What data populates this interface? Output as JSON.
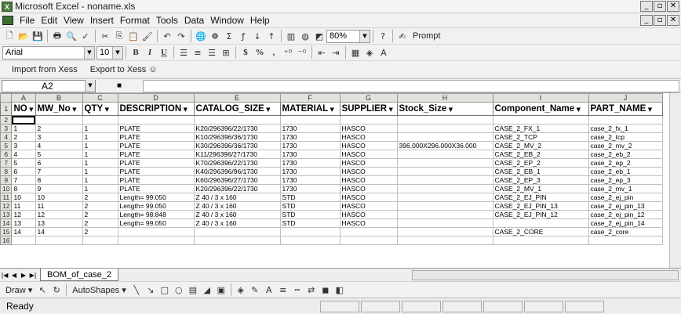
{
  "window": {
    "app_icon_text": "X",
    "title": "Microsoft Excel - noname.xls",
    "btn_min": "_",
    "btn_max": "▫",
    "btn_close": "✕"
  },
  "menu": [
    "File",
    "Edit",
    "View",
    "Insert",
    "Format",
    "Tools",
    "Data",
    "Window",
    "Help"
  ],
  "toolbar": {
    "zoom": "80%",
    "help": "?",
    "prompt": "Prompt",
    "font": "Arial",
    "font_size": "10",
    "bold": "B",
    "italic": "I",
    "underline": "U",
    "currency": "$",
    "percent": "%",
    "comma": ",",
    "import_xess": "Import from Xess",
    "export_xess": "Export to Xess ☺"
  },
  "formula_bar": {
    "name_box": "A2",
    "fx": "■",
    "value": ""
  },
  "grid": {
    "columns": [
      "A",
      "B",
      "C",
      "D",
      "E",
      "F",
      "G",
      "H",
      "I",
      "J"
    ],
    "headers": [
      "NO",
      "MW_No",
      "QTY",
      "DESCRIPTION",
      "CATALOG_SIZE",
      "MATERIAL",
      "SUPPLIER",
      "Stock_Size",
      "Component_Name",
      "PART_NAME"
    ],
    "row_numbers": [
      "1",
      "2",
      "3",
      "4",
      "5",
      "6",
      "7",
      "8",
      "9",
      "10",
      "11",
      "12",
      "13",
      "14",
      "15",
      "16"
    ],
    "rows": [
      [
        "",
        "",
        "",
        "",
        "",
        "",
        "",
        "",
        "",
        ""
      ],
      [
        "1",
        "2",
        "1",
        "PLATE",
        "K20/296396/22/1730",
        "1730",
        "HASCO",
        "",
        "CASE_2_FX_1",
        "case_2_fx_1"
      ],
      [
        "2",
        "3",
        "1",
        "PLATE",
        "K10/296396/36/1730",
        "1730",
        "HASCO",
        "",
        "CASE_2_TCP",
        "case_2_tcp"
      ],
      [
        "3",
        "4",
        "1",
        "PLATE",
        "K30/296396/36/1730",
        "1730",
        "HASCO",
        "396.000X296.000X36.000",
        "CASE_2_MV_2",
        "case_2_mv_2"
      ],
      [
        "4",
        "5",
        "1",
        "PLATE",
        "K11/296396/27/1730",
        "1730",
        "HASCO",
        "",
        "CASE_2_EB_2",
        "case_2_eb_2"
      ],
      [
        "5",
        "6",
        "1",
        "PLATE",
        "K70/296396/22/1730",
        "1730",
        "HASCO",
        "",
        "CASE_2_EP_2",
        "case_2_ep_2"
      ],
      [
        "6",
        "7",
        "1",
        "PLATE",
        "K40/296396/96/1730",
        "1730",
        "HASCO",
        "",
        "CASE_2_EB_1",
        "case_2_eb_1"
      ],
      [
        "7",
        "8",
        "1",
        "PLATE",
        "K60/296396/27/1730",
        "1730",
        "HASCO",
        "",
        "CASE_2_EP_3",
        "case_2_ep_3"
      ],
      [
        "8",
        "9",
        "1",
        "PLATE",
        "K20/296396/22/1730",
        "1730",
        "HASCO",
        "",
        "CASE_2_MV_1",
        "case_2_mv_1"
      ],
      [
        "10",
        "10",
        "2",
        "Length= 99.050",
        "Z 40 / 3 x 160",
        "STD",
        "HASCO",
        "",
        "CASE_2_EJ_PIN",
        "case_2_ej_pin"
      ],
      [
        "11",
        "11",
        "2",
        "Length= 99.050",
        "Z 40 / 3 x 160",
        "STD",
        "HASCO",
        "",
        "CASE_2_EJ_PIN_13",
        "case_2_ej_pin_13"
      ],
      [
        "12",
        "12",
        "2",
        "Length= 98.848",
        "Z 40 / 3 x 160",
        "STD",
        "HASCO",
        "",
        "CASE_2_EJ_PIN_12",
        "case_2_ej_pin_12"
      ],
      [
        "13",
        "13",
        "2",
        "Length= 99.050",
        "Z 40 / 3 x 160",
        "STD",
        "HASCO",
        "",
        "",
        "case_2_ej_pin_14"
      ],
      [
        "14",
        "14",
        "2",
        "",
        "",
        "",
        "",
        "",
        "CASE_2_CORE",
        "case_2_core"
      ],
      [
        "",
        "",
        "",
        "",
        "",
        "",
        "",
        "",
        "",
        ""
      ]
    ]
  },
  "sheet_tabs": [
    "BOM_of_case_2"
  ],
  "drawing": {
    "draw": "Draw ▾",
    "autoshapes": "AutoShapes ▾"
  },
  "status": {
    "text": "Ready"
  }
}
